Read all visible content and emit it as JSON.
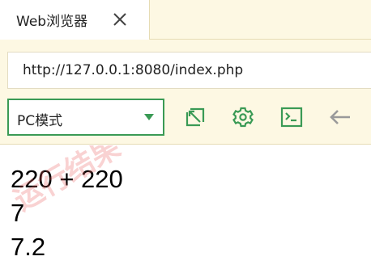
{
  "tab": {
    "title": "Web浏览器",
    "close_icon": "close-icon"
  },
  "address_bar": {
    "url": "http://127.0.0.1:8080/index.php"
  },
  "mode_select": {
    "selected": "PC模式",
    "icon": "chevron-down-icon"
  },
  "toolbar": {
    "buttons": [
      {
        "icon": "open-external-icon"
      },
      {
        "icon": "gear-icon"
      },
      {
        "icon": "console-icon"
      },
      {
        "icon": "back-arrow-icon"
      }
    ]
  },
  "output": {
    "lines": [
      "220 + 220",
      "7",
      "7.2"
    ],
    "watermark": "运行结果"
  },
  "colors": {
    "accent_green": "#3a9a55",
    "toolbar_bg": "#fdf8e3",
    "icon_gray": "#9a9a9a",
    "watermark_red": "#e85c5c"
  }
}
